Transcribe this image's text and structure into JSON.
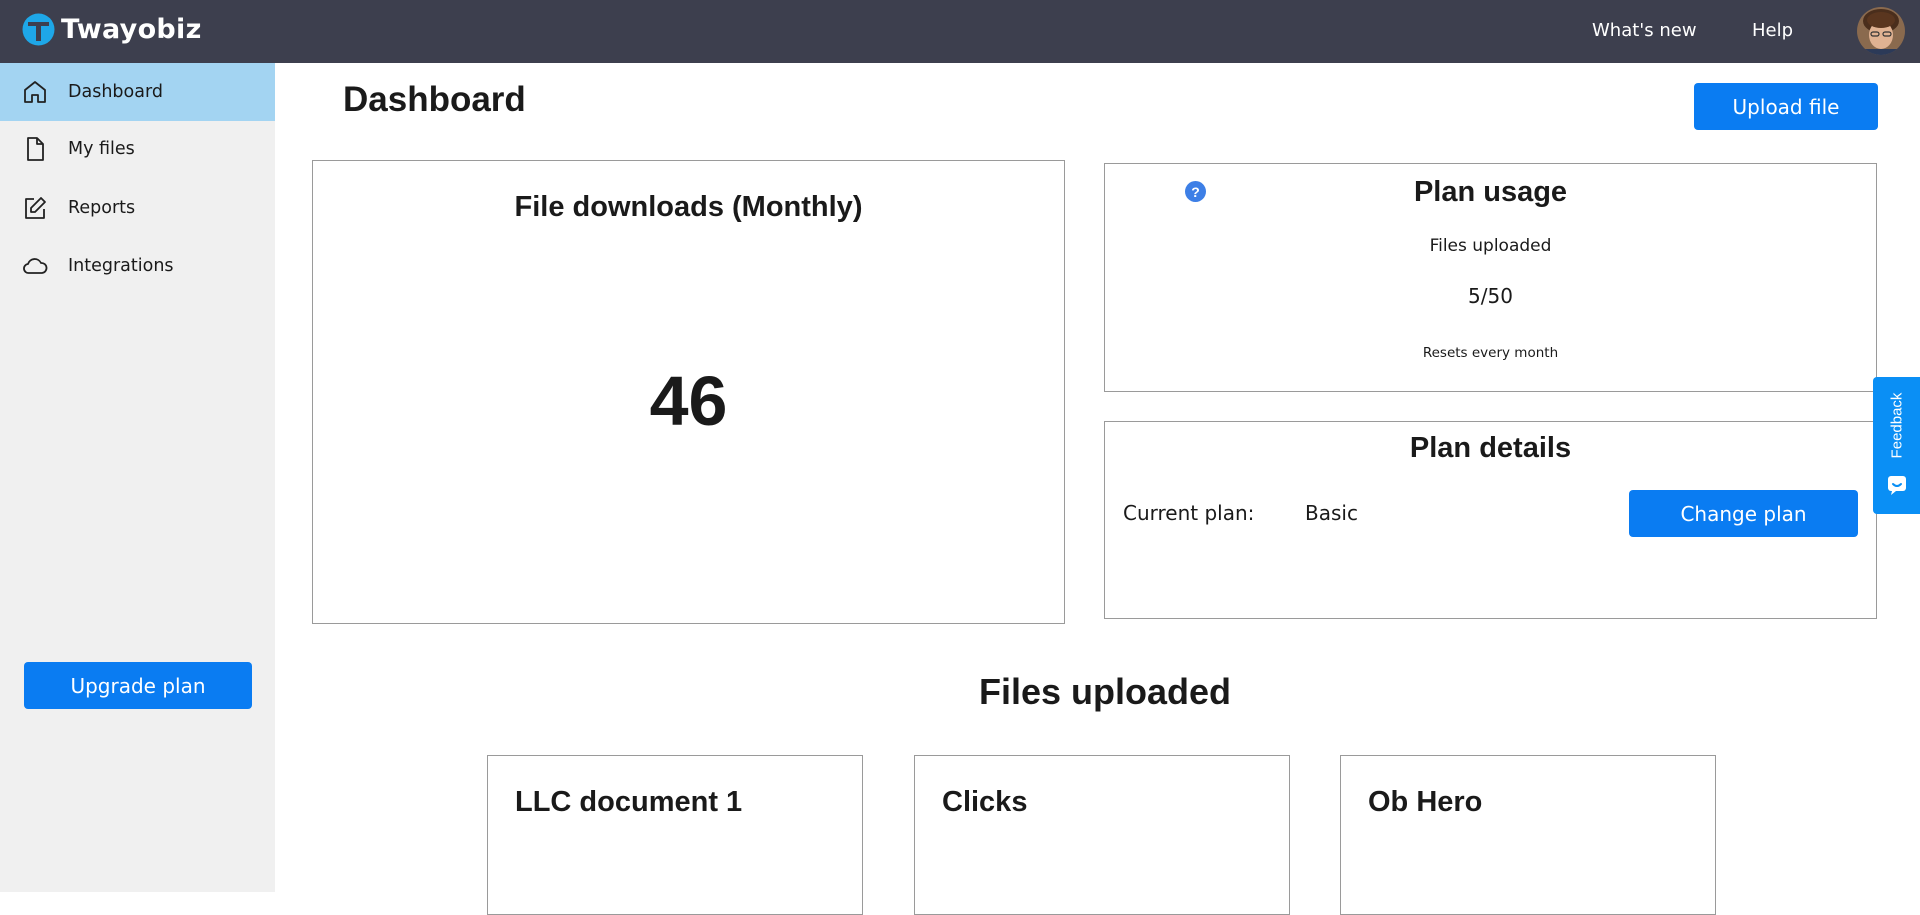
{
  "app": {
    "brand_name": "Twayobiz",
    "accent_color": "#0a7cf2",
    "header_color": "#3d3f4e"
  },
  "topnav": {
    "whats_new": "What's new",
    "help": "Help"
  },
  "sidebar": {
    "items": [
      {
        "label": "Dashboard",
        "icon": "home-icon",
        "active": true
      },
      {
        "label": "My files",
        "icon": "file-icon",
        "active": false
      },
      {
        "label": "Reports",
        "icon": "edit-icon",
        "active": false
      },
      {
        "label": "Integrations",
        "icon": "cloud-icon",
        "active": false
      }
    ],
    "upgrade_label": "Upgrade plan"
  },
  "main": {
    "title": "Dashboard",
    "upload_label": "Upload file",
    "downloads": {
      "title": "File downloads (Monthly)",
      "value": "46"
    },
    "usage": {
      "title": "Plan usage",
      "label": "Files uploaded",
      "count": "5/50",
      "reset_note": "Resets every month"
    },
    "details": {
      "title": "Plan details",
      "current_plan_label": "Current plan:",
      "current_plan_value": "Basic",
      "change_label": "Change plan"
    },
    "files_section": {
      "title": "Files uploaded",
      "files": [
        {
          "name": "LLC document 1"
        },
        {
          "name": "Clicks"
        },
        {
          "name": "Ob Hero"
        }
      ]
    }
  },
  "feedback": {
    "label": "Feedback"
  }
}
